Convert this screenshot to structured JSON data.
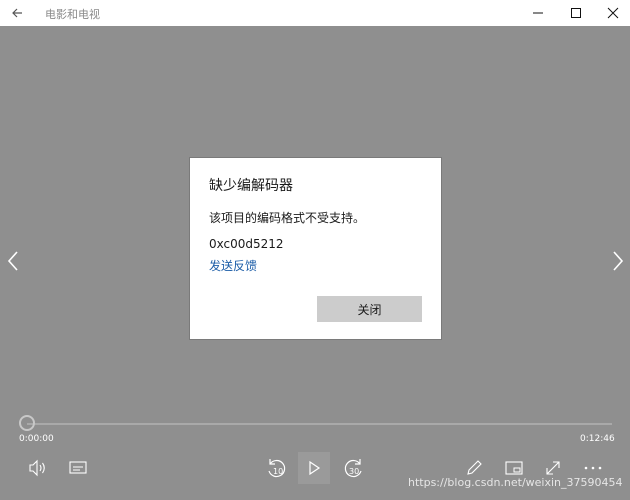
{
  "window": {
    "title": "电影和电视",
    "icons": {
      "back": "back-arrow-icon",
      "minimize": "minimize-icon",
      "maximize": "maximize-icon",
      "close": "close-icon"
    }
  },
  "dialog": {
    "title": "缺少编解码器",
    "message": "该项目的编码格式不受支持。",
    "error_code": "0xc00d5212",
    "link": "发送反馈",
    "button": "关闭"
  },
  "player": {
    "current_time": "0:00:00",
    "total_time": "0:12:46",
    "progress": 0,
    "skip_back_label": "10",
    "skip_forward_label": "30"
  },
  "colors": {
    "link": "#1d5ea8",
    "overlay": "#8f8f8f",
    "button": "#cccccc"
  },
  "watermark": "https://blog.csdn.net/weixin_37590454"
}
